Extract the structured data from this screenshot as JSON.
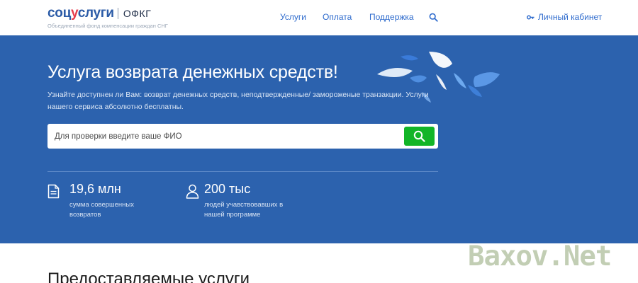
{
  "header": {
    "logo_brand_main": "соц",
    "logo_brand_accent": "у",
    "logo_brand_rest": "слуги",
    "logo_org": "ОФКГ",
    "logo_subtitle": "Объединенный фонд компенсации граждан СНГ",
    "nav": [
      {
        "label": "Услуги"
      },
      {
        "label": "Оплата"
      },
      {
        "label": "Поддержка"
      }
    ],
    "search_icon": "search-icon",
    "cabinet_label": "Личный кабинет",
    "cabinet_icon": "key-icon"
  },
  "hero": {
    "title": "Услуга возврата денежных средств!",
    "description": "Узнайте доступнен ли Вам: возврат денежных средств, неподтвержденные/ замороженые транзакции. Услуги нашего сервиса абсолютно бесплатны.",
    "search_placeholder": "Для проверки введите ваше ФИО",
    "stats": [
      {
        "icon": "document-icon",
        "value": "19,6 млн",
        "label": "сумма совершенных возвратов"
      },
      {
        "icon": "user-icon",
        "value": "200 тыс",
        "label": "людей учавствовавших в нашей программе"
      }
    ]
  },
  "section": {
    "title": "Предоставляемые услуги"
  },
  "watermark": "Baxov.Net",
  "colors": {
    "brand_blue": "#2b5ba7",
    "brand_red": "#e63b4c",
    "hero_bg": "#2c62ae",
    "nav_link": "#2e6bcd",
    "search_button": "#12b527"
  }
}
